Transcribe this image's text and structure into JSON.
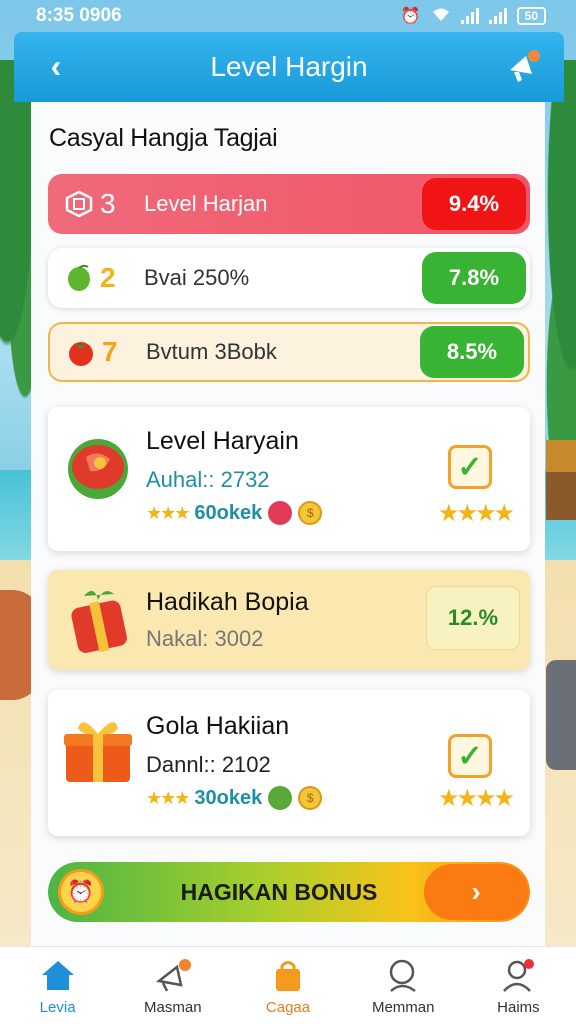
{
  "status_bar": {
    "time": "8:35 0906",
    "battery": "50"
  },
  "header": {
    "title": "Level Hargin"
  },
  "section": {
    "title": "Casyal Hangja Tagjai"
  },
  "bars": [
    {
      "num": "3",
      "label": "Level Harjan",
      "pct": "9.4%"
    },
    {
      "num": "2",
      "label": "Bvai 250%",
      "pct": "7.8%"
    },
    {
      "num": "7",
      "label": "Bvtum 3Bobk",
      "pct": "8.5%"
    }
  ],
  "cards": [
    {
      "title": "Level Haryain",
      "sub": "Auhal:: 2732",
      "stars": "★★★",
      "cookie": "60okek",
      "big_stars": "★★★★"
    },
    {
      "title": "Hadikah Bopia",
      "sub": "Nakal: 3002",
      "pct": "12.%"
    },
    {
      "title": "Gola Hakiian",
      "sub": "Dannl:: 2102",
      "stars": "★★★",
      "cookie": "30okek",
      "big_stars": "★★★★"
    }
  ],
  "bonus": {
    "label": "HAGIKAN BONUS",
    "arrow": "›"
  },
  "nav": [
    {
      "label": "Levia"
    },
    {
      "label": "Masman"
    },
    {
      "label": "Cagaa"
    },
    {
      "label": "Memman"
    },
    {
      "label": "Haims"
    }
  ],
  "colors": {
    "header": "#189ad8",
    "accent_red": "#f01414",
    "accent_green": "#38b334",
    "accent_orange": "#fb7a12"
  }
}
